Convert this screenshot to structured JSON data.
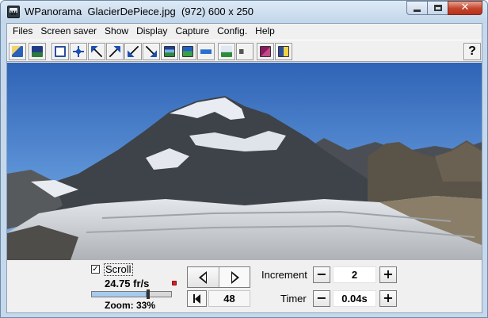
{
  "window": {
    "title": "WPanorama  GlacierDePiece.jpg  (972) 600 x 250",
    "minimize_icon": "minimize-icon",
    "maximize_icon": "maximize-icon",
    "close_glyph": "✕"
  },
  "menu": [
    "Files",
    "Screen saver",
    "Show",
    "Display",
    "Capture",
    "Config.",
    "Help"
  ],
  "toolbar": {
    "icons": [
      "open-file-icon",
      "open-image-icon",
      "full-size-icon",
      "move-icon",
      "scroll-up-left-icon",
      "scroll-up-right-icon",
      "scroll-down-left-icon",
      "scroll-down-right-icon",
      "screen-saver-icon",
      "wallpaper-icon",
      "strip-view-icon",
      "landscape-icon",
      "sound-icon",
      "book-icon",
      "help-book-icon"
    ],
    "help_label": "?"
  },
  "controls": {
    "scroll_checked": "✓",
    "scroll_label": "Scroll",
    "frame_rate": "24.75 fr/s",
    "zoom_label": "Zoom: 33%",
    "zoom_fraction": 0.33,
    "frame_number": "48",
    "increment_label": "Increment",
    "increment_value": "2",
    "timer_label": "Timer",
    "timer_value": "0.04s",
    "minus": "−",
    "plus": "+"
  },
  "colors": {
    "sky": "#4a7fcc",
    "glacier": "#c9cdd2",
    "close_button": "#c4432b"
  }
}
